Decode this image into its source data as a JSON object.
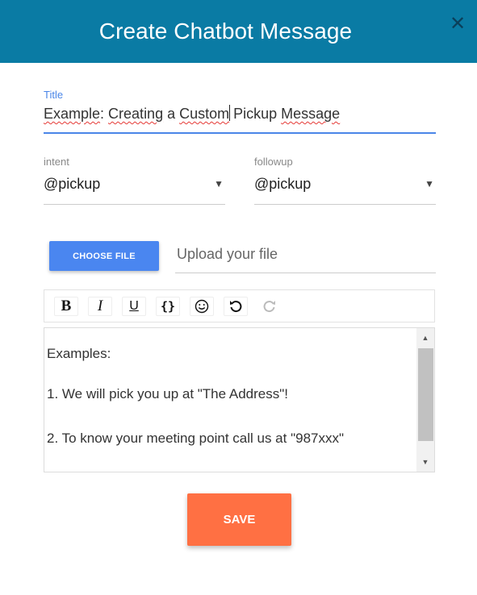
{
  "header": {
    "title": "Create Chatbot Message",
    "close_icon": "close-icon"
  },
  "title_field": {
    "label": "Title",
    "value_parts": [
      "Example",
      ": ",
      "Creating",
      " a ",
      "Custom",
      "",
      " Pickup ",
      "Message"
    ]
  },
  "intent": {
    "label": "intent",
    "value": "@pickup"
  },
  "followup": {
    "label": "followup",
    "value": "@pickup"
  },
  "upload": {
    "button_label": "CHOOSE FILE",
    "placeholder": "Upload your file"
  },
  "toolbar": {
    "bold": "B",
    "italic": "I",
    "underline": "U",
    "code": "{}",
    "emoji_icon": "smiley-icon",
    "undo_icon": "undo-icon",
    "redo_icon": "redo-icon"
  },
  "editor": {
    "lines": [
      "Examples:",
      "1. We will pick you up at \"The Address\"!",
      "2. To know your meeting point call us at \"987xxx\""
    ]
  },
  "save_label": "SAVE",
  "colors": {
    "header": "#0a7ba4",
    "accent": "#4a86e8",
    "save": "#ff7043"
  }
}
